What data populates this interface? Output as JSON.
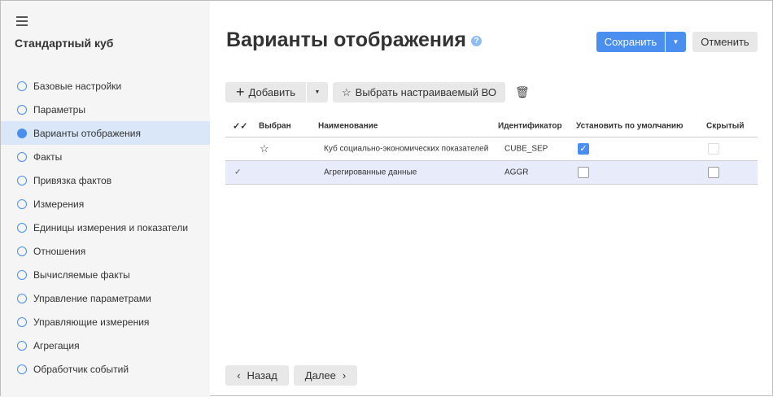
{
  "sidebar": {
    "title": "Стандартный куб",
    "items": [
      {
        "label": "Базовые настройки"
      },
      {
        "label": "Параметры"
      },
      {
        "label": "Варианты отображения"
      },
      {
        "label": "Факты"
      },
      {
        "label": "Привязка фактов"
      },
      {
        "label": "Измерения"
      },
      {
        "label": "Единицы измерения и показатели"
      },
      {
        "label": "Отношения"
      },
      {
        "label": "Вычисляемые факты"
      },
      {
        "label": "Управление параметрами"
      },
      {
        "label": "Управляющие измерения"
      },
      {
        "label": "Агрегация"
      },
      {
        "label": "Обработчик событий"
      }
    ],
    "active_index": 2
  },
  "header": {
    "title": "Варианты отображения",
    "help": "?",
    "save": "Сохранить",
    "cancel": "Отменить"
  },
  "toolbar": {
    "add": "Добавить",
    "choose": "Выбрать настраиваемый ВО"
  },
  "table": {
    "columns": [
      "Выбран",
      "Наименование",
      "Идентификатор",
      "Установить по умолчанию",
      "Скрытый"
    ],
    "rows": [
      {
        "name": "Куб социально-экономических показателей",
        "id": "CUBE_SEP",
        "default": true,
        "hidden": false,
        "starred": true
      },
      {
        "name": "Агрегированные данные",
        "id": "AGGR",
        "default": false,
        "hidden": false,
        "selected": true
      }
    ]
  },
  "footer": {
    "back": "Назад",
    "next": "Далее"
  }
}
